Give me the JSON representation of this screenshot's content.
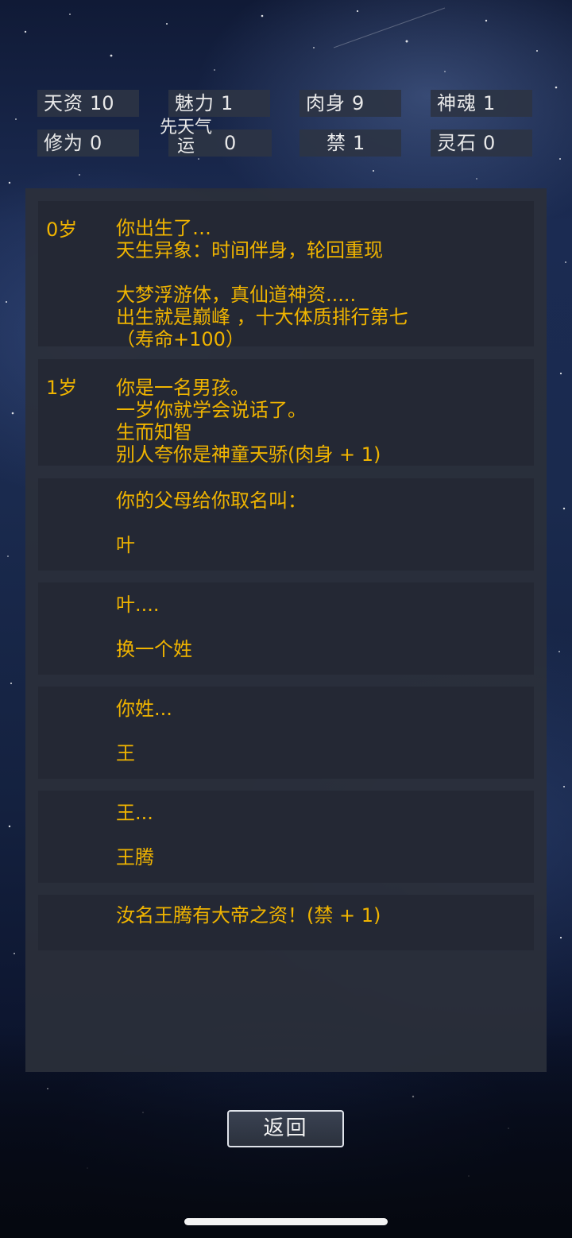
{
  "stats": {
    "row1": [
      {
        "label": "天资",
        "value": "10"
      },
      {
        "label": "魅力",
        "value": "1"
      },
      {
        "label": "肉身",
        "value": "9"
      },
      {
        "label": "神魂",
        "value": "1"
      }
    ],
    "row2": [
      {
        "label": "修为",
        "value": "0"
      },
      {
        "label": "先天气运",
        "value": "0"
      },
      {
        "label": "禁",
        "value": "1"
      },
      {
        "label": "灵石",
        "value": "0"
      }
    ]
  },
  "log": [
    {
      "age": "0岁",
      "lines": [
        "你出生了…",
        "天生异象：时间伴身，轮回重现",
        "",
        "大梦浮游体，真仙道神资.....",
        "出生就是巅峰 ，十大体质排行第七",
        "（寿命+100）"
      ]
    },
    {
      "age": "1岁",
      "lines": [
        "你是一名男孩。",
        "一岁你就学会说话了。",
        "生而知智",
        "别人夸你是神童天骄(肉身 + 1)"
      ]
    },
    {
      "age": "",
      "lines": [
        "你的父母给你取名叫：",
        "叶"
      ]
    },
    {
      "age": "",
      "lines": [
        "叶....",
        "换一个姓"
      ]
    },
    {
      "age": "",
      "lines": [
        "你姓...",
        "王"
      ]
    },
    {
      "age": "",
      "lines": [
        "王...",
        "王腾"
      ]
    },
    {
      "age": "",
      "lines": [
        "汝名王腾有大帝之资！(禁 + 1)"
      ]
    }
  ],
  "buttons": {
    "back_label": "返回"
  },
  "colors": {
    "log_text": "#f0b400",
    "stat_text": "#e9e9e9",
    "panel_bg": "#2b2f3a",
    "entry_bg": "#242834"
  }
}
